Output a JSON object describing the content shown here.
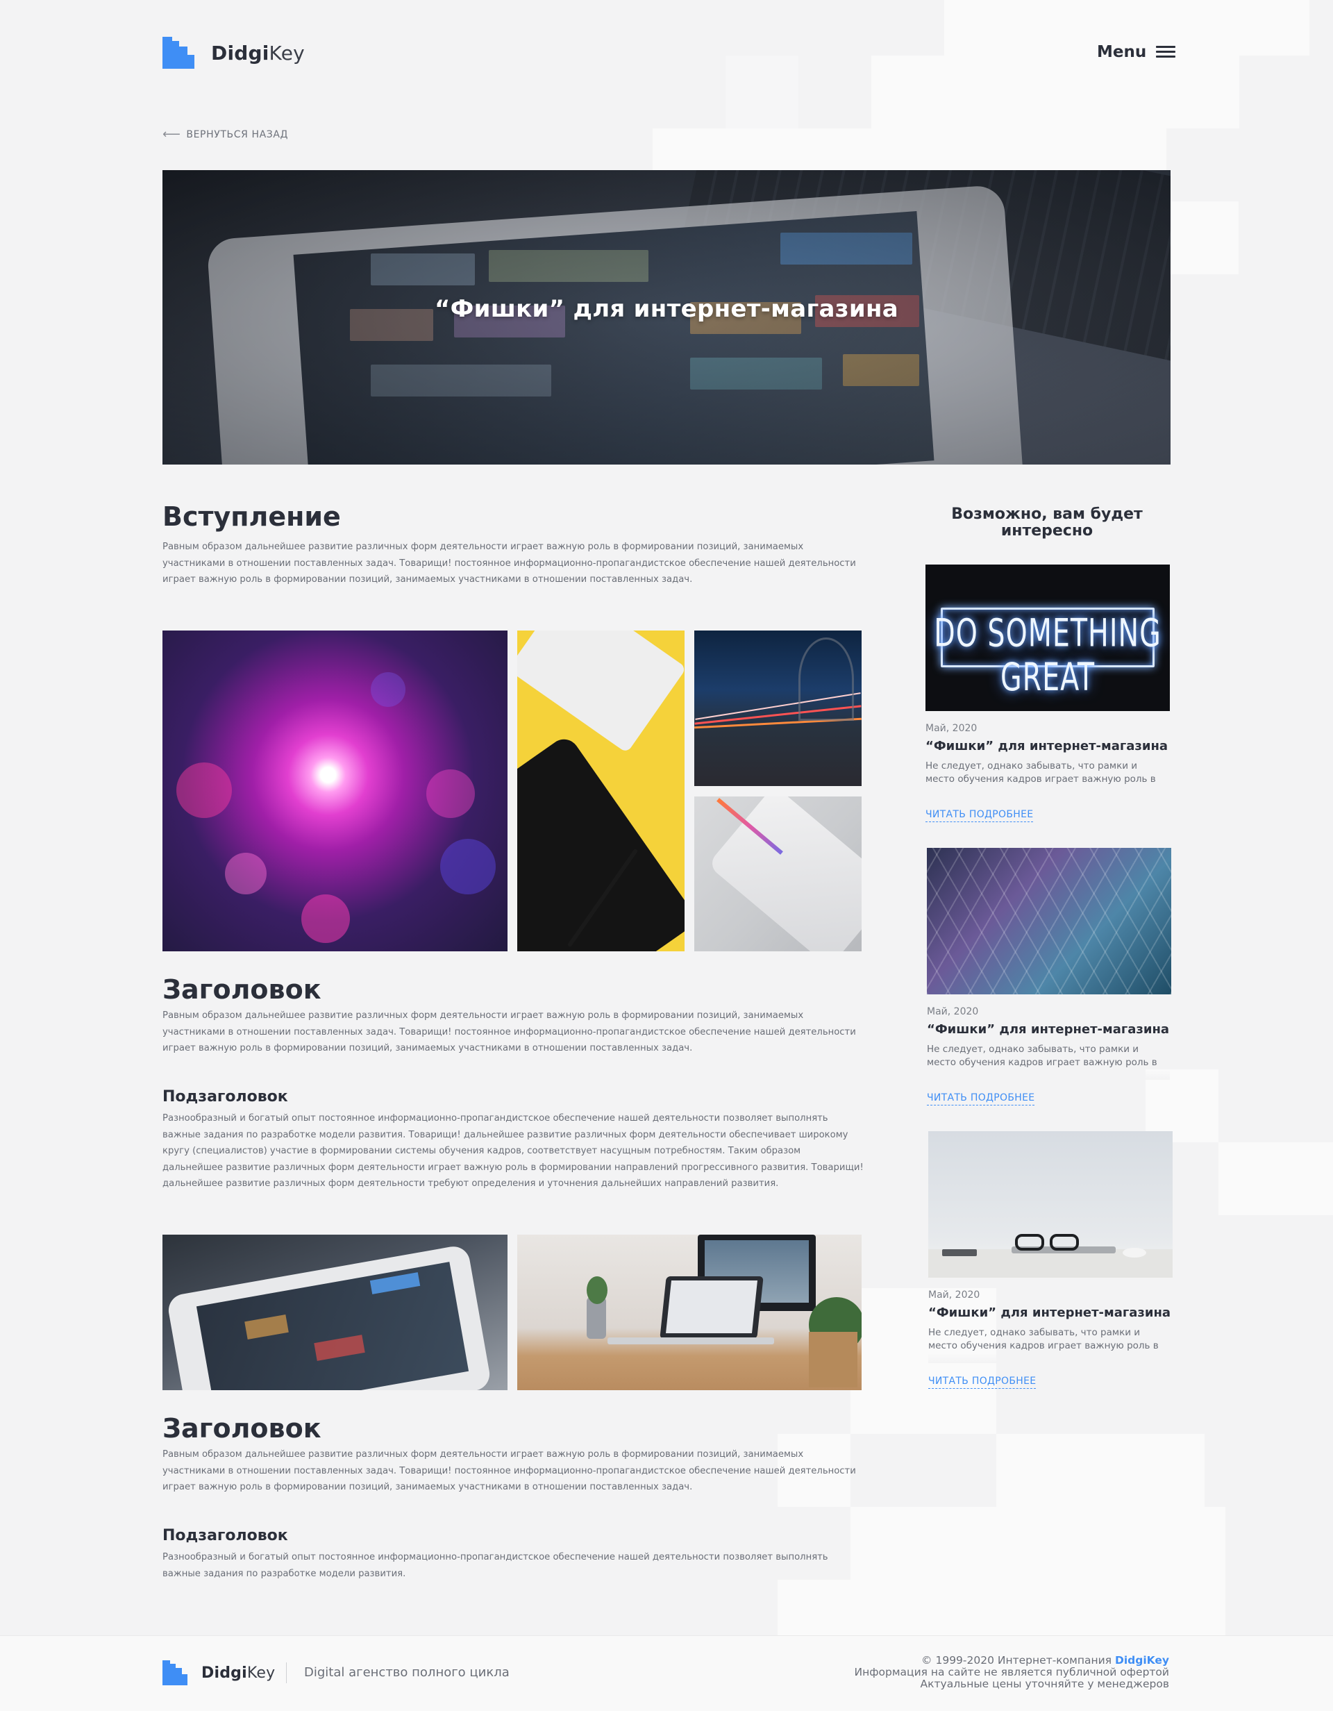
{
  "header": {
    "logo_bold": "Didgi",
    "logo_light": "Key",
    "menu_label": "Menu"
  },
  "back_link": "ВЕРНУТЬСЯ НАЗАД",
  "hero": {
    "title": "“Фишки” для интернет-магазина"
  },
  "article": {
    "intro_heading": "Вступление",
    "intro_text": "Равным образом дальнейшее развитие различных форм деятельности играет важную роль в формировании позиций, занимаемых участниками в отношении поставленных задач. Товарищи! постоянное информационно-пропагандистское обеспечение нашей деятельности играет важную роль в формировании позиций, занимаемых участниками в отношении поставленных задач.",
    "section1_heading": "Заголовок",
    "section1_text": "Равным образом дальнейшее развитие различных форм деятельности играет важную роль в формировании позиций, занимаемых участниками в отношении поставленных задач. Товарищи! постоянное информационно-пропагандистское обеспечение нашей деятельности играет важную роль в формировании позиций, занимаемых участниками в отношении поставленных задач.",
    "section1_sub": "Подзаголовок",
    "section1_sub_text": "Разнообразный и богатый опыт постоянное информационно-пропагандистское обеспечение нашей деятельности позволяет выполнять важные задания по разработке модели развития. Товарищи! дальнейшее развитие различных форм деятельности обеспечивает широкому кругу (специалистов) участие в формировании системы обучения кадров, соответствует насущным потребностям. Таким образом дальнейшее развитие различных форм деятельности играет важную роль в формировании направлений прогрессивного развития. Товарищи! дальнейшее развитие различных форм деятельности требуют определения и уточнения дальнейших направлений развития.",
    "section2_heading": "Заголовок",
    "section2_text": "Равным образом дальнейшее развитие различных форм деятельности играет важную роль в формировании позиций, занимаемых участниками в отношении поставленных задач. Товарищи! постоянное информационно-пропагандистское обеспечение нашей деятельности играет важную роль в формировании позиций, занимаемых участниками в отношении поставленных задач.",
    "section2_sub": "Подзаголовок",
    "section2_sub_text": "Разнообразный и богатый опыт постоянное информационно-пропагандистское обеспечение нашей деятельности позволяет выполнять важные задания по разработке модели развития."
  },
  "sidebar": {
    "title": "Возможно, вам будет интересно",
    "neon_text": "DO SOMETHING GREAT",
    "cards": [
      {
        "date": "Май, 2020",
        "title": "“Фишки” для интернет-магазина",
        "text": "Не следует, однако забывать, что рамки и место обучения кадров играет важную роль в формировании",
        "link": "ЧИТАТЬ ПОДРОБНЕЕ"
      },
      {
        "date": "Май, 2020",
        "title": "“Фишки” для интернет-магазина",
        "text": "Не следует, однако забывать, что рамки и место обучения кадров играет важную роль в формировании",
        "link": "ЧИТАТЬ ПОДРОБНЕЕ"
      },
      {
        "date": "Май, 2020",
        "title": "“Фишки” для интернет-магазина",
        "text": "Не следует, однако забывать, что рамки и место обучения кадров играет важную роль в формировании",
        "link": "ЧИТАТЬ ПОДРОБНЕЕ"
      }
    ]
  },
  "footer": {
    "logo_bold": "Didgi",
    "logo_light": "Key",
    "tagline": "Digital агенство полного цикла",
    "copyright_prefix": "© 1999-2020 Интернет-компания",
    "copyright_brand": "DidgiKey",
    "line2": "Информация на сайте не является публичной офертой",
    "line3": "Актуальные цены уточняйте у менеджеров"
  },
  "colors": {
    "accent": "#3f8ef5",
    "text": "#2b2f3a",
    "muted": "#6a6e77",
    "background": "#f3f3f4"
  },
  "icons": [
    "logo-icon",
    "back-arrow-icon",
    "menu-icon"
  ]
}
